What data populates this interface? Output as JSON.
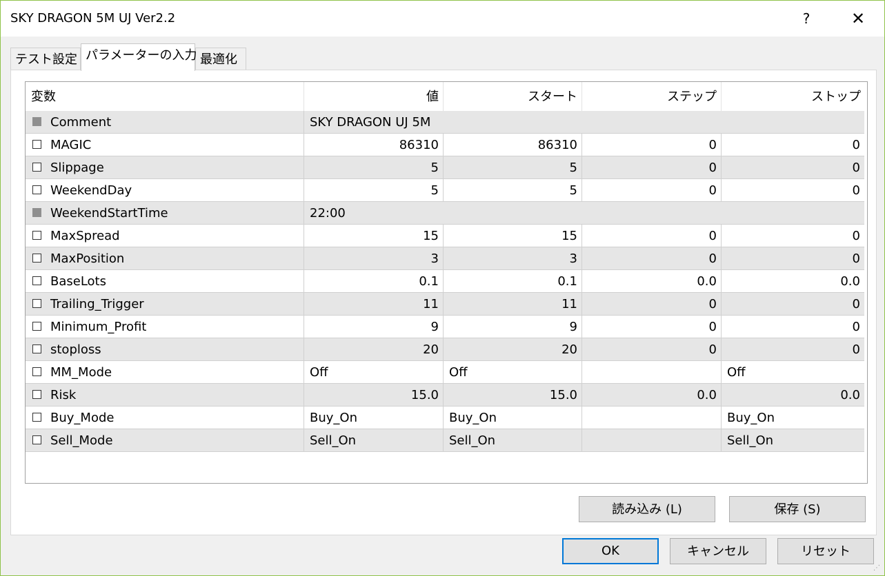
{
  "window": {
    "title": "SKY DRAGON 5M UJ Ver2.2",
    "help_label": "?",
    "close_label": "✕"
  },
  "tabs": [
    {
      "label": "テスト設定"
    },
    {
      "label": "パラメーターの入力"
    },
    {
      "label": "最適化"
    }
  ],
  "grid": {
    "columns": [
      "変数",
      "値",
      "スタート",
      "ステップ",
      "ストップ"
    ],
    "rows": [
      {
        "name": "Comment",
        "value": "SKY DRAGON UJ 5M",
        "start": "",
        "step": "",
        "stop": "",
        "checkbox_disabled": true
      },
      {
        "name": "MAGIC",
        "value": "86310",
        "start": "86310",
        "step": "0",
        "stop": "0",
        "checkbox_disabled": false
      },
      {
        "name": "Slippage",
        "value": "5",
        "start": "5",
        "step": "0",
        "stop": "0",
        "checkbox_disabled": false
      },
      {
        "name": "WeekendDay",
        "value": "5",
        "start": "5",
        "step": "0",
        "stop": "0",
        "checkbox_disabled": false
      },
      {
        "name": "WeekendStartTime",
        "value": "22:00",
        "start": "",
        "step": "",
        "stop": "",
        "checkbox_disabled": true
      },
      {
        "name": "MaxSpread",
        "value": "15",
        "start": "15",
        "step": "0",
        "stop": "0",
        "checkbox_disabled": false
      },
      {
        "name": "MaxPosition",
        "value": "3",
        "start": "3",
        "step": "0",
        "stop": "0",
        "checkbox_disabled": false
      },
      {
        "name": "BaseLots",
        "value": "0.1",
        "start": "0.1",
        "step": "0.0",
        "stop": "0.0",
        "checkbox_disabled": false
      },
      {
        "name": "Trailing_Trigger",
        "value": "11",
        "start": "11",
        "step": "0",
        "stop": "0",
        "checkbox_disabled": false
      },
      {
        "name": "Minimum_Profit",
        "value": "9",
        "start": "9",
        "step": "0",
        "stop": "0",
        "checkbox_disabled": false
      },
      {
        "name": "stoploss",
        "value": "20",
        "start": "20",
        "step": "0",
        "stop": "0",
        "checkbox_disabled": false
      },
      {
        "name": "MM_Mode",
        "value": "Off",
        "start": "Off",
        "step": "",
        "stop": "Off",
        "checkbox_disabled": false
      },
      {
        "name": "Risk",
        "value": "15.0",
        "start": "15.0",
        "step": "0.0",
        "stop": "0.0",
        "checkbox_disabled": false
      },
      {
        "name": "Buy_Mode",
        "value": "Buy_On",
        "start": "Buy_On",
        "step": "",
        "stop": "Buy_On",
        "checkbox_disabled": false
      },
      {
        "name": "Sell_Mode",
        "value": "Sell_On",
        "start": "Sell_On",
        "step": "",
        "stop": "Sell_On",
        "checkbox_disabled": false
      }
    ]
  },
  "buttons": {
    "load": "読み込み (L)",
    "save": "保存 (S)",
    "ok": "OK",
    "cancel": "キャンセル",
    "reset": "リセット"
  },
  "colors": {
    "window_border": "#8fc34a",
    "default_button_border": "#0078d7",
    "row_shade": "#e6e6e6"
  }
}
